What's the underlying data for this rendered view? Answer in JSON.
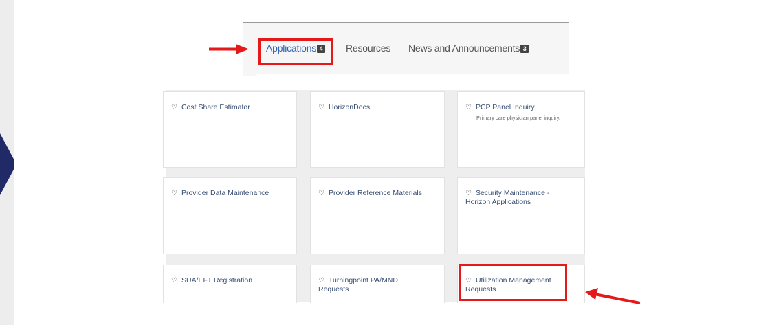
{
  "tabs": [
    {
      "label": "Applications",
      "badge": "4",
      "active": true
    },
    {
      "label": "Resources",
      "badge": "",
      "active": false
    },
    {
      "label": "News and Announcements",
      "badge": "3",
      "active": false
    }
  ],
  "tiles": [
    {
      "title": "Cost Share Estimator",
      "description": ""
    },
    {
      "title": "HorizonDocs",
      "description": ""
    },
    {
      "title": "PCP Panel Inquiry",
      "description": "Primary care physician panel inquiry."
    },
    {
      "title": "Provider Data Maintenance",
      "description": ""
    },
    {
      "title": "Provider Reference Materials",
      "description": ""
    },
    {
      "title": "Security Maintenance - Horizon Applications",
      "description": ""
    },
    {
      "title": "SUA/EFT Registration",
      "description": ""
    },
    {
      "title": "Turningpoint PA/MND Requests",
      "description": ""
    },
    {
      "title": "Utilization Management Requests",
      "description": ""
    }
  ],
  "icons": {
    "favorite": "heart-outline-icon",
    "annotation": "red-arrow",
    "nav": "chevron-right-icon"
  },
  "colors": {
    "highlight": "#e51919",
    "active_tab": "#2e61b0",
    "nav_arrow": "#1f2a66"
  }
}
